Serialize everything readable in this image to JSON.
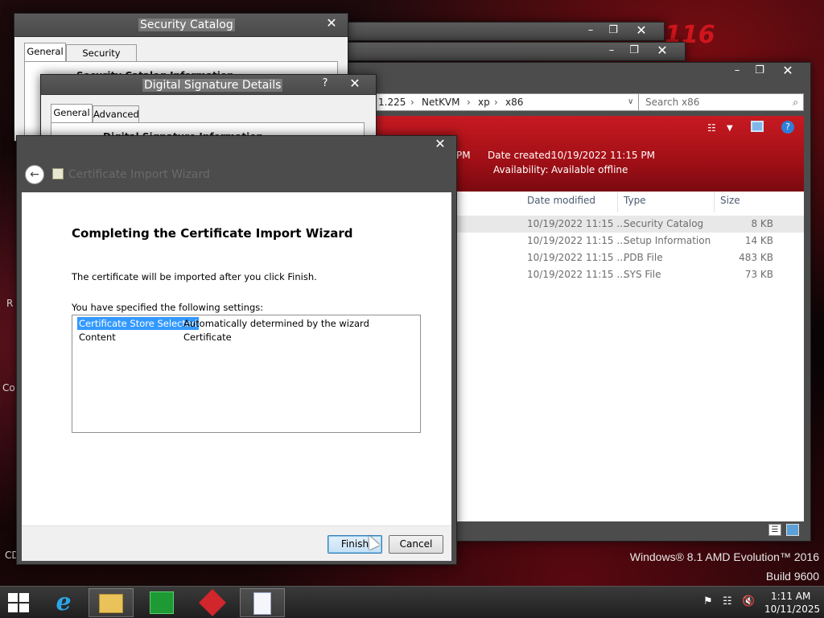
{
  "desktop": {
    "watermark_line1": "Windows® 8.1 AMD Evolution™ 2016",
    "watermark_line2": "Build 9600",
    "edge_labels": [
      "R",
      "Co",
      "CD"
    ]
  },
  "security_catalog": {
    "title": "Security Catalog",
    "tabs": [
      "General",
      "Security Catalog"
    ],
    "section_heading": "Security Catalog Information"
  },
  "signature_details": {
    "title": "Digital Signature Details",
    "help": "?",
    "tabs": [
      "General",
      "Advanced"
    ],
    "section_heading": "Digital Signature Information"
  },
  "explorer": {
    "breadcrumb": [
      "1.225",
      "NetKVM",
      "xp",
      "x86"
    ],
    "search_placeholder": "Search x86",
    "details": {
      "modified_label": "PM",
      "created_label": "Date created:",
      "created_value": "10/19/2022 11:15 PM",
      "availability_label": "Availability:",
      "availability_value": "Available offline"
    },
    "columns": {
      "date": "Date modified",
      "type": "Type",
      "size": "Size"
    },
    "rows": [
      {
        "date": "10/19/2022 11:15 ...",
        "type": "Security Catalog",
        "size": "8 KB"
      },
      {
        "date": "10/19/2022 11:15 ...",
        "type": "Setup Information",
        "size": "14 KB"
      },
      {
        "date": "10/19/2022 11:15 ...",
        "type": "PDB File",
        "size": "483 KB"
      },
      {
        "date": "10/19/2022 11:15 ...",
        "type": "SYS File",
        "size": "73 KB"
      }
    ]
  },
  "wizard": {
    "title": "Certificate Import Wizard",
    "heading": "Completing the Certificate Import Wizard",
    "message": "The certificate will be imported after you click Finish.",
    "settings_label": "You have specified the following settings:",
    "settings": [
      {
        "name": "Certificate Store Selected",
        "value": "Automatically determined by the wizard"
      },
      {
        "name": "Content",
        "value": "Certificate"
      }
    ],
    "finish": "Finish",
    "cancel": "Cancel"
  },
  "taskbar": {
    "time": "1:11 AM",
    "date": "10/11/2025"
  },
  "colors": {
    "accent_red": "#c81a22",
    "selection_blue": "#3399ff"
  }
}
